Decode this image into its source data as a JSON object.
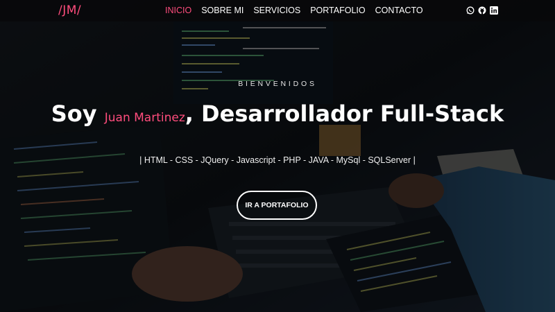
{
  "brand": {
    "logo_text": "/JM/"
  },
  "nav": {
    "items": [
      {
        "label": "INICIO",
        "active": true
      },
      {
        "label": "SOBRE MI",
        "active": false
      },
      {
        "label": "SERVICIOS",
        "active": false
      },
      {
        "label": "PORTAFOLIO",
        "active": false
      },
      {
        "label": "CONTACTO",
        "active": false
      }
    ]
  },
  "social": {
    "icons": [
      "whatsapp-icon",
      "github-icon",
      "linkedin-icon"
    ]
  },
  "hero": {
    "greeting": "BIENVENIDOS",
    "headline_prefix": "Soy ",
    "name": "Juan Martinez",
    "headline_suffix": ", Desarrollador Full-Stack",
    "skills": "| HTML - CSS - JQuery - Javascript - PHP - JAVA - MySql - SQLServer |",
    "cta_label": "IR A PORTAFOLIO"
  },
  "colors": {
    "accent": "#ff4d7d",
    "text": "#ffffff",
    "navbar_bg": "#08080a"
  }
}
